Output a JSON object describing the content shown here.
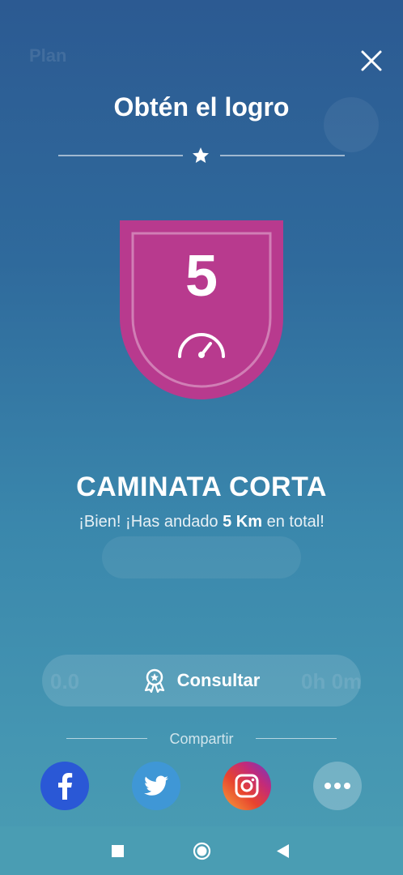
{
  "background_ui": {
    "title": "Plan",
    "left_value": "0.0",
    "right_value": "0h 0m"
  },
  "dialog": {
    "title": "Obtén el logro",
    "badge_number": "5",
    "achievement_name": "CAMINATA CORTA",
    "description_prefix": "¡Bien! ¡Has andado ",
    "description_bold": "5 Km",
    "description_suffix": " en total!",
    "consult_label": "Consultar",
    "share_label": "Compartir"
  },
  "colors": {
    "badge": "#b83a8e",
    "facebook": "#2a58d6",
    "twitter": "#3f97d6",
    "accent_white": "#ffffff"
  },
  "social_buttons": [
    "facebook-icon",
    "twitter-icon",
    "instagram-icon",
    "more-icon"
  ],
  "navbar": [
    "recent-apps-icon",
    "home-icon",
    "back-icon"
  ]
}
